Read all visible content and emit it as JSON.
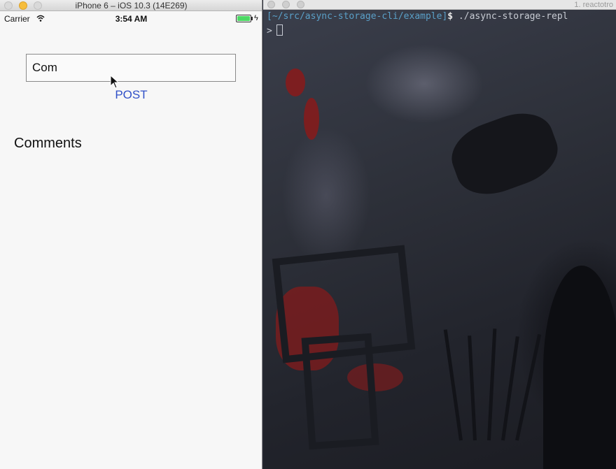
{
  "simulator": {
    "window_title": "iPhone 6 – iOS 10.3 (14E269)",
    "status": {
      "carrier": "Carrier",
      "time": "3:54 AM",
      "battery_level": 1.0
    },
    "input": {
      "value": "Com"
    },
    "post_label": "POST",
    "comments_heading": "Comments",
    "colors": {
      "link": "#3050c8",
      "battery": "#4cd964"
    }
  },
  "terminal": {
    "window_title": "1. reactotro",
    "line1": {
      "path": "[~/src/async-storage-cli/example]",
      "dollar": "$",
      "command": " ./async-storage-repl"
    },
    "line2": {
      "prompt": ">"
    }
  }
}
